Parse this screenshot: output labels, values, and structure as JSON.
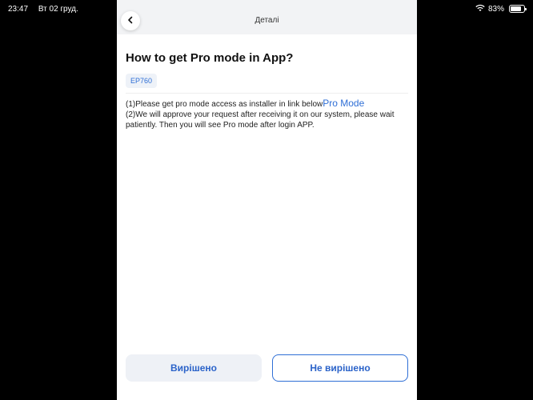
{
  "status_bar": {
    "time": "23:47",
    "date": "Вт 02 груд.",
    "battery": "83%",
    "battery_level": 0.83
  },
  "nav": {
    "title": "Деталі"
  },
  "article": {
    "title": "How to get Pro mode in App?",
    "tag": "EP760",
    "line1": "(1)Please get pro mode access as installer in link below",
    "link": "Pro Mode",
    "line2": "(2)We will approve your request after receiving it on our system, please wait patiently. Then you will see Pro mode after login APP."
  },
  "buttons": {
    "resolved": "Вирішено",
    "not_resolved": "Не вирішено"
  },
  "colors": {
    "accent": "#2f6fd6",
    "nav_bg": "#f2f3f5",
    "secondary_button_bg": "#eef1f6"
  }
}
